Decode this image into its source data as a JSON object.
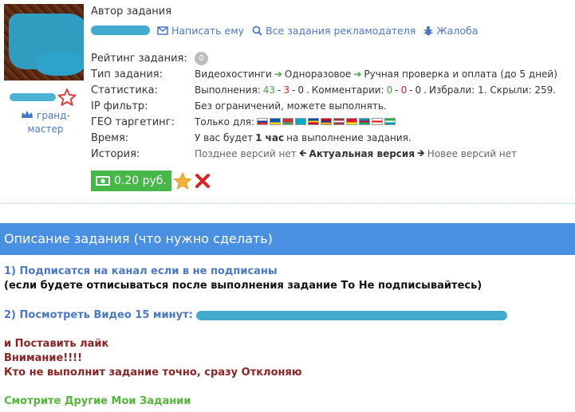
{
  "author": {
    "title": "Автор задания",
    "links": {
      "write": "Написать ему",
      "all_tasks": "Все задания рекламодателя",
      "complaint": "Жалоба"
    },
    "rank": [
      "гранд-",
      "мастер"
    ]
  },
  "stats": {
    "rating_label": "Рейтинг задания:",
    "rating_value": "0",
    "type_label": "Тип задания:",
    "type_parts": [
      "Видеохостинги",
      "Одноразовое",
      "Ручная проверка и оплата (до 5 дней)"
    ],
    "statistics_label": "Статистика:",
    "statistics": {
      "done_label": "Выполнения:",
      "done_green": "43",
      "done_red": "3",
      "done_gray": "0",
      "comments_label": "Комментарии:",
      "comments_green": "0",
      "comments_red": "0",
      "comments_gray": "0",
      "fav_text": "Избрали: 1. Скрыли: 259."
    },
    "ip_label": "IP фильтр:",
    "ip_value": "Без ограничений, можете выполнять.",
    "geo_label": "ГЕО таргетинг:",
    "geo_prefix": "Только для:",
    "geo_flags": [
      [
        "#ffffff",
        "#0039a6",
        "#d52b1e"
      ],
      [
        "#0057b7",
        "#0057b7",
        "#ffd700"
      ],
      [
        "#c8313e",
        "#c8313e",
        "#4aa657"
      ],
      [
        "#00afca",
        "#00afca",
        "#00afca"
      ],
      [
        "#0046ae",
        "#ffd200",
        "#cc092f"
      ],
      [
        "#d90012",
        "#0033a0",
        "#f2a800"
      ],
      [
        "#9e3039",
        "#ffffff",
        "#9e3039"
      ],
      [
        "#e8112d",
        "#e8112d",
        "#ffef00"
      ],
      [
        "#0092bc",
        "#e4002b",
        "#00af66"
      ],
      [
        "#ffffff",
        "#ff0000",
        "#ffffff"
      ],
      [
        "#1eb53a",
        "#ffffff",
        "#0099b5"
      ]
    ],
    "time_label": "Время:",
    "time_pre": "У вас будет",
    "time_bold": "1 час",
    "time_post": "на выполнение задания.",
    "history_label": "История:",
    "history_prev": "Позднее версий нет",
    "history_current": "Актуальная версия",
    "history_next": "Новее версий нет"
  },
  "price": "0.20 руб.",
  "description": {
    "header": "Описание задания (что нужно сделать)",
    "line1": "1) Подписатся на канал если в не подписаны",
    "line2": "(если будете отписываться после выполнения задание То Не подписывайтесь)",
    "line3_label": "2) Посмотреть Видео 15 минут:",
    "line4": "и Поставить лайк",
    "line5": "Внимание!!!!",
    "line6": "Кто не выполнит задание точно, сразу Отклоняю",
    "line7": "Смотрите Другие Мои Задании"
  },
  "colors": {
    "accent_blue": "#4a90e2",
    "link_blue": "#4b78c6",
    "green": "#45b848",
    "red": "#dd2222"
  }
}
